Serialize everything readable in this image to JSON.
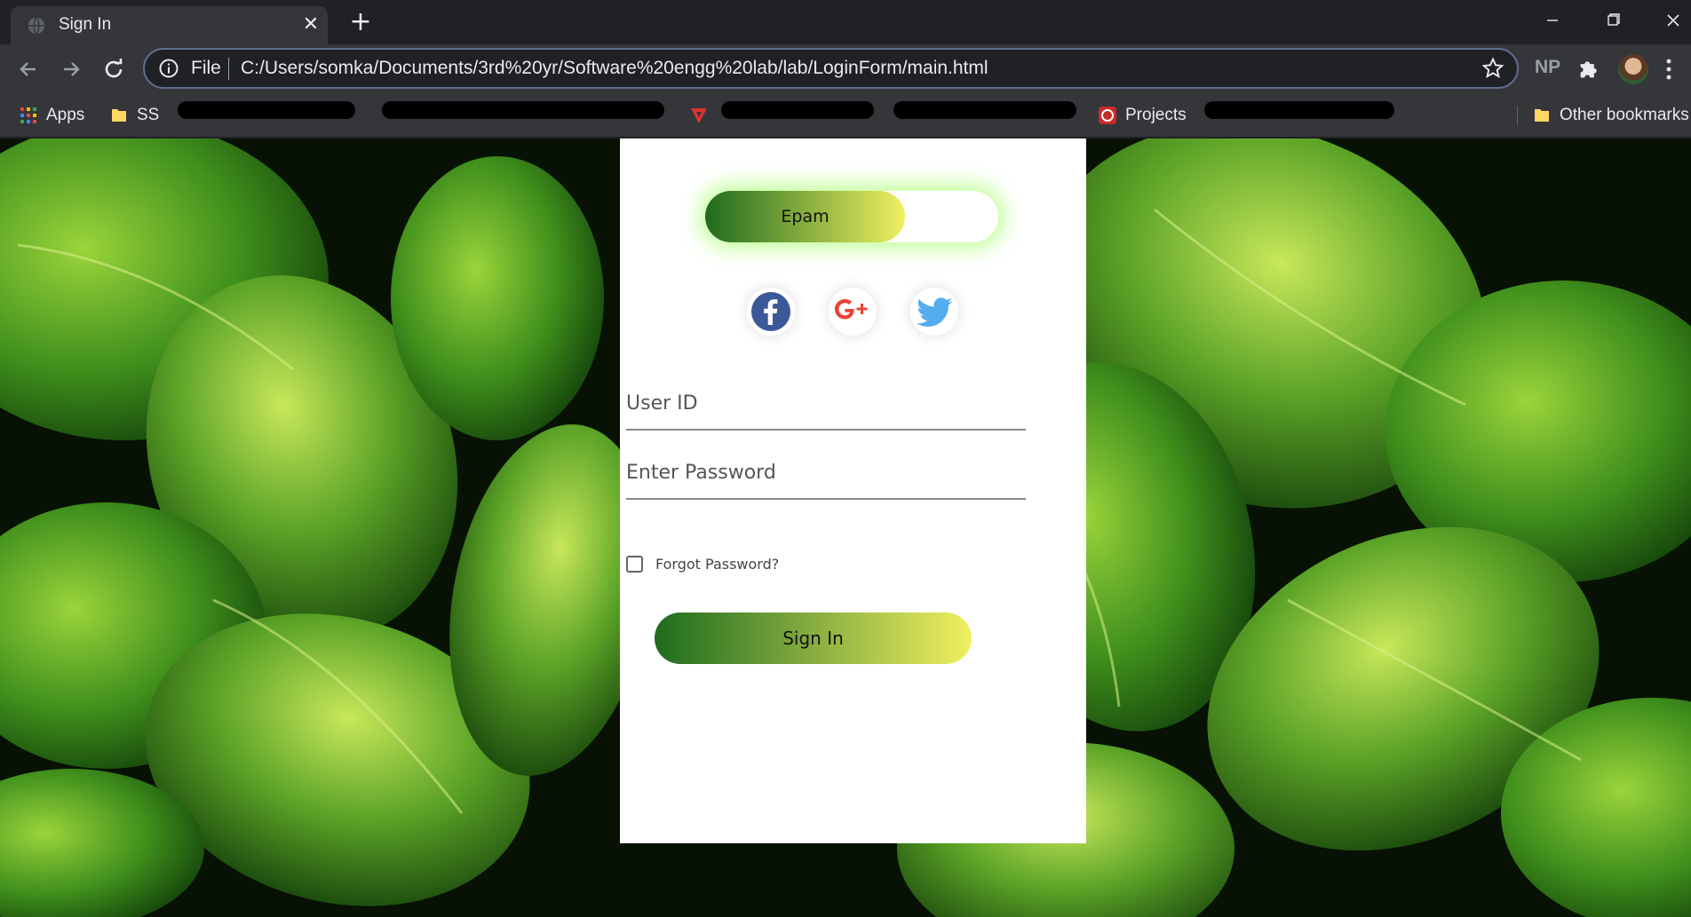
{
  "browser": {
    "tab": {
      "title": "Sign In"
    },
    "address": {
      "scheme_label": "File",
      "url": "C:/Users/somka/Documents/3rd%20yr/Software%20engg%20lab/lab/LoginForm/main.html"
    },
    "extension_badge": "NP",
    "bookmarks": {
      "apps": "Apps",
      "ss": "SS",
      "projects": "Projects",
      "other": "Other bookmarks"
    }
  },
  "login": {
    "toggle_label": "Epam",
    "social_icons": [
      "facebook-icon",
      "google-plus-icon",
      "twitter-icon"
    ],
    "user_id_placeholder": "User ID",
    "password_placeholder": "Enter Password",
    "forgot_label": "Forgot Password?",
    "signin_label": "Sign In"
  },
  "colors": {
    "gradient_start": "#1e6b1e",
    "gradient_end": "#f0f060",
    "glow": "#96ff50",
    "facebook": "#3b5998",
    "google": "#ea4335",
    "twitter": "#55acee"
  }
}
